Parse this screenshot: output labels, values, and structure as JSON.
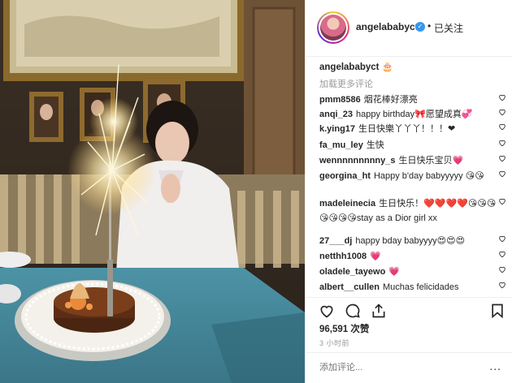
{
  "post": {
    "username": "angelababyct",
    "verified_icon": "verified-badge-icon",
    "separator": "•",
    "follow_state": "已关注",
    "caption_user": "angelababyct",
    "caption_text": "🎂",
    "load_more": "加载更多评论",
    "likes": "96,591 次赞",
    "time": "3 小时前",
    "add_comment_placeholder": "添加评论...",
    "more_options": "..."
  },
  "comments": [
    {
      "user": "pmm8586",
      "text": "烟花棒好漂亮"
    },
    {
      "user": "anqi_23",
      "text": "happy birthday🎀愿望成真💞"
    },
    {
      "user": "k.ying17",
      "text": "生日快樂丫丫丫！！！❤"
    },
    {
      "user": "fa_mu_ley",
      "text": "生快"
    },
    {
      "user": "wennnnnnnnny_s",
      "text": "生日快乐宝贝💗"
    },
    {
      "user": "georgina_ht",
      "text": "Happy b'day babyyyyy 😘😘"
    },
    {
      "user": "madeleinecia",
      "text": "生日快乐！❤️❤️❤️❤️😘😘😘😘😘😘😘stay as a Dior girl xx"
    },
    {
      "user": "27___dj",
      "text": "happy bday babyyyy😍😍😍"
    },
    {
      "user": "netthh1008",
      "text": "💗"
    },
    {
      "user": "oladele_tayewo",
      "text": "💗"
    },
    {
      "user": "albert__cullen",
      "text": "Muchas felicidades"
    }
  ],
  "icons": {
    "heart": "heart-outline-icon",
    "comment": "comment-bubble-icon",
    "share": "share-icon",
    "bookmark": "bookmark-icon"
  }
}
